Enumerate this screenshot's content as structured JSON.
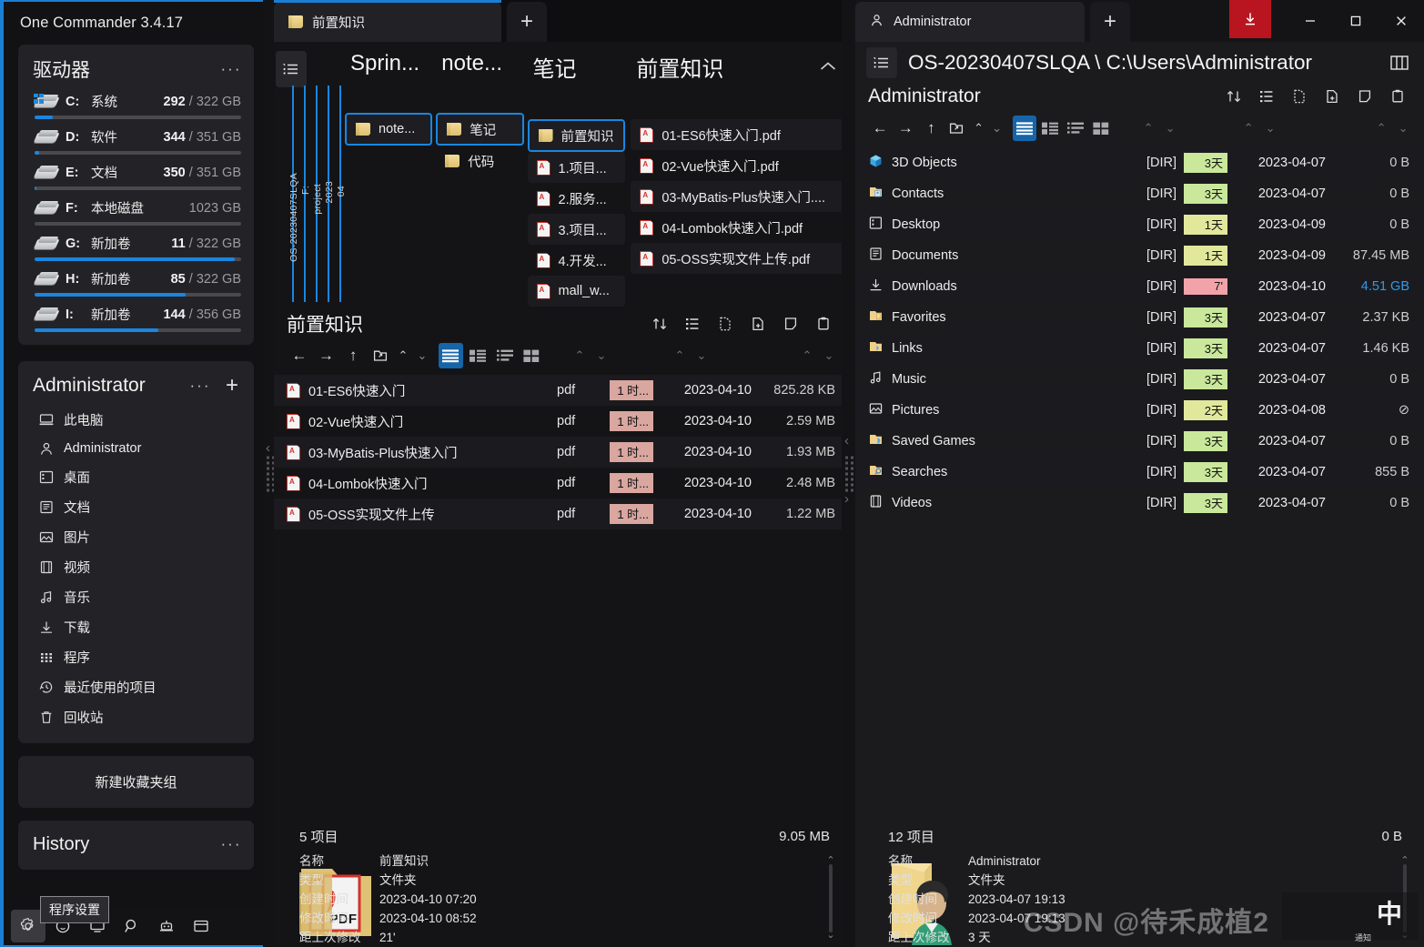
{
  "app": {
    "title": "One Commander 3.4.17"
  },
  "sidebar": {
    "drives_card": {
      "title": "驱动器",
      "more": "···"
    },
    "drives": [
      {
        "letter": "C:",
        "label": "系统",
        "used": "292",
        "sep": " / ",
        "total": "322 GB",
        "pct": 9
      },
      {
        "letter": "D:",
        "label": "软件",
        "used": "344",
        "sep": " / ",
        "total": "351 GB",
        "pct": 2
      },
      {
        "letter": "E:",
        "label": "文档",
        "used": "350",
        "sep": " / ",
        "total": "351 GB",
        "pct": 1
      },
      {
        "letter": "F:",
        "label": "本地磁盘",
        "used": "",
        "sep": "",
        "total": "1023 GB",
        "pct": 0
      },
      {
        "letter": "G:",
        "label": "新加卷",
        "used": "11",
        "sep": " / ",
        "total": "322 GB",
        "pct": 97
      },
      {
        "letter": "H:",
        "label": "新加卷",
        "used": "85",
        "sep": " / ",
        "total": "322 GB",
        "pct": 73
      },
      {
        "letter": "I:",
        "label": "新加卷",
        "used": "144",
        "sep": " / ",
        "total": "356 GB",
        "pct": 60
      }
    ],
    "fav_card": {
      "title": "Administrator",
      "more": "···",
      "add": "+"
    },
    "favorites": [
      {
        "icon": "this-pc-icon",
        "label": "此电脑"
      },
      {
        "icon": "user-icon",
        "label": "Administrator"
      },
      {
        "icon": "desktop-icon",
        "label": "桌面"
      },
      {
        "icon": "documents-icon",
        "label": "文档"
      },
      {
        "icon": "pictures-icon",
        "label": "图片"
      },
      {
        "icon": "videos-icon",
        "label": "视频"
      },
      {
        "icon": "music-icon",
        "label": "音乐"
      },
      {
        "icon": "download-icon",
        "label": "下载"
      },
      {
        "icon": "apps-icon",
        "label": "程序"
      },
      {
        "icon": "recent-icon",
        "label": "最近使用的项目"
      },
      {
        "icon": "trash-icon",
        "label": "回收站"
      }
    ],
    "new_group_label": "新建收藏夹组",
    "history_card": {
      "title": "History",
      "more": "···"
    },
    "bottom_tooltip": "程序设置"
  },
  "middle": {
    "tab": {
      "label": "前置知识",
      "add": "+"
    },
    "breadcrumb_rails": [
      "OS-20230407SLQA",
      "F:",
      "project",
      "2023",
      "04"
    ],
    "columns": [
      {
        "header": "Sprin...",
        "items": [
          {
            "type": "folder",
            "label": "note...",
            "selected": true
          }
        ]
      },
      {
        "header": "note...",
        "items": [
          {
            "type": "folder",
            "label": "笔记",
            "selected": true
          },
          {
            "type": "folder",
            "label": "代码",
            "selected": false
          }
        ]
      },
      {
        "header": "笔记",
        "items": [
          {
            "type": "folder",
            "label": "前置知识",
            "selected": true
          },
          {
            "type": "pdf",
            "label": "1.项目...",
            "selected": false
          },
          {
            "type": "pdf",
            "label": "2.服务...",
            "selected": false
          },
          {
            "type": "pdf",
            "label": "3.项目...",
            "selected": false
          },
          {
            "type": "pdf",
            "label": "4.开发...",
            "selected": false
          },
          {
            "type": "pdf",
            "label": "mall_w...",
            "selected": false
          }
        ]
      },
      {
        "header": "前置知识",
        "items": [
          {
            "type": "pdf",
            "label": "01-ES6快速入门.pdf",
            "selected": false
          },
          {
            "type": "pdf",
            "label": "02-Vue快速入门.pdf",
            "selected": false
          },
          {
            "type": "pdf",
            "label": "03-MyBatis-Plus快速入门....",
            "selected": false
          },
          {
            "type": "pdf",
            "label": "04-Lombok快速入门.pdf",
            "selected": false
          },
          {
            "type": "pdf",
            "label": "05-OSS实现文件上传.pdf",
            "selected": false
          }
        ]
      }
    ],
    "panel": {
      "title": "前置知识"
    },
    "files": [
      {
        "name": "01-ES6快速入门",
        "type": "pdf",
        "badge": "1 时...",
        "date": "2023-04-10",
        "size": "825.28 KB"
      },
      {
        "name": "02-Vue快速入门",
        "type": "pdf",
        "badge": "1 时...",
        "date": "2023-04-10",
        "size": "2.59 MB"
      },
      {
        "name": "03-MyBatis-Plus快速入门",
        "type": "pdf",
        "badge": "1 时...",
        "date": "2023-04-10",
        "size": "1.93 MB"
      },
      {
        "name": "04-Lombok快速入门",
        "type": "pdf",
        "badge": "1 时...",
        "date": "2023-04-10",
        "size": "2.48 MB"
      },
      {
        "name": "05-OSS实现文件上传",
        "type": "pdf",
        "badge": "1 时...",
        "date": "2023-04-10",
        "size": "1.22 MB"
      }
    ],
    "footer": {
      "count": "5 项目",
      "total_size": "9.05 MB",
      "keys": [
        "名称",
        "类型",
        "创建时间",
        "修改时间",
        "距上次修改"
      ],
      "values": [
        "前置知识",
        "文件夹",
        "2023-04-10  07:20",
        "2023-04-10  08:52",
        "21'"
      ]
    }
  },
  "right": {
    "tab": {
      "label": "Administrator",
      "add": "+"
    },
    "window_buttons": {
      "download": "↓",
      "minimize": "—",
      "maximize": "▢",
      "close": "✕"
    },
    "path": "OS-20230407SLQA \\ C:\\Users\\Administrator",
    "panel": {
      "title": "Administrator"
    },
    "items": [
      {
        "name": "3D Objects",
        "icon": "3d-objects-icon",
        "type": "[DIR]",
        "badge": "3天",
        "badge_color": "#c9e89b",
        "date": "2023-04-07",
        "size": "0 B"
      },
      {
        "name": "Contacts",
        "icon": "contacts-icon",
        "type": "[DIR]",
        "badge": "3天",
        "badge_color": "#c9e89b",
        "date": "2023-04-07",
        "size": "0 B"
      },
      {
        "name": "Desktop",
        "icon": "desktop-icon",
        "type": "[DIR]",
        "badge": "1天",
        "badge_color": "#e2e89b",
        "date": "2023-04-09",
        "size": "0 B"
      },
      {
        "name": "Documents",
        "icon": "documents-icon",
        "type": "[DIR]",
        "badge": "1天",
        "badge_color": "#e2e89b",
        "date": "2023-04-09",
        "size": "87.45 MB"
      },
      {
        "name": "Downloads",
        "icon": "download-icon",
        "type": "[DIR]",
        "badge": "7'",
        "badge_color": "#f2a3aa",
        "date": "2023-04-10",
        "size": "4.51 GB",
        "size_color": "#2f9bea"
      },
      {
        "name": "Favorites",
        "icon": "favorites-icon",
        "type": "[DIR]",
        "badge": "3天",
        "badge_color": "#c9e89b",
        "date": "2023-04-07",
        "size": "2.37 KB"
      },
      {
        "name": "Links",
        "icon": "links-icon",
        "type": "[DIR]",
        "badge": "3天",
        "badge_color": "#c9e89b",
        "date": "2023-04-07",
        "size": "1.46 KB"
      },
      {
        "name": "Music",
        "icon": "music-icon",
        "type": "[DIR]",
        "badge": "3天",
        "badge_color": "#c9e89b",
        "date": "2023-04-07",
        "size": "0 B"
      },
      {
        "name": "Pictures",
        "icon": "pictures-icon",
        "type": "[DIR]",
        "badge": "2天",
        "badge_color": "#e2e89b",
        "date": "2023-04-08",
        "size": "⊘"
      },
      {
        "name": "Saved Games",
        "icon": "saved-games-icon",
        "type": "[DIR]",
        "badge": "3天",
        "badge_color": "#c9e89b",
        "date": "2023-04-07",
        "size": "0 B"
      },
      {
        "name": "Searches",
        "icon": "searches-icon",
        "type": "[DIR]",
        "badge": "3天",
        "badge_color": "#c9e89b",
        "date": "2023-04-07",
        "size": "855 B"
      },
      {
        "name": "Videos",
        "icon": "videos-icon",
        "type": "[DIR]",
        "badge": "3天",
        "badge_color": "#c9e89b",
        "date": "2023-04-07",
        "size": "0 B"
      }
    ],
    "footer": {
      "count": "12 项目",
      "total_size": "0 B",
      "keys": [
        "名称",
        "类型",
        "创建时间",
        "修改时间",
        "距上次修改"
      ],
      "values": [
        "Administrator",
        "文件夹",
        "2023-04-07  19:13",
        "2023-04-07  19:13",
        "3 天"
      ]
    }
  },
  "watermark": {
    "text": "CSDN @待禾成植2",
    "cn": "中",
    "small": "通知"
  },
  "colors": {
    "accent": "#1a7fd4",
    "accent_bar": "#1a86e0",
    "download_red": "#b81520"
  }
}
